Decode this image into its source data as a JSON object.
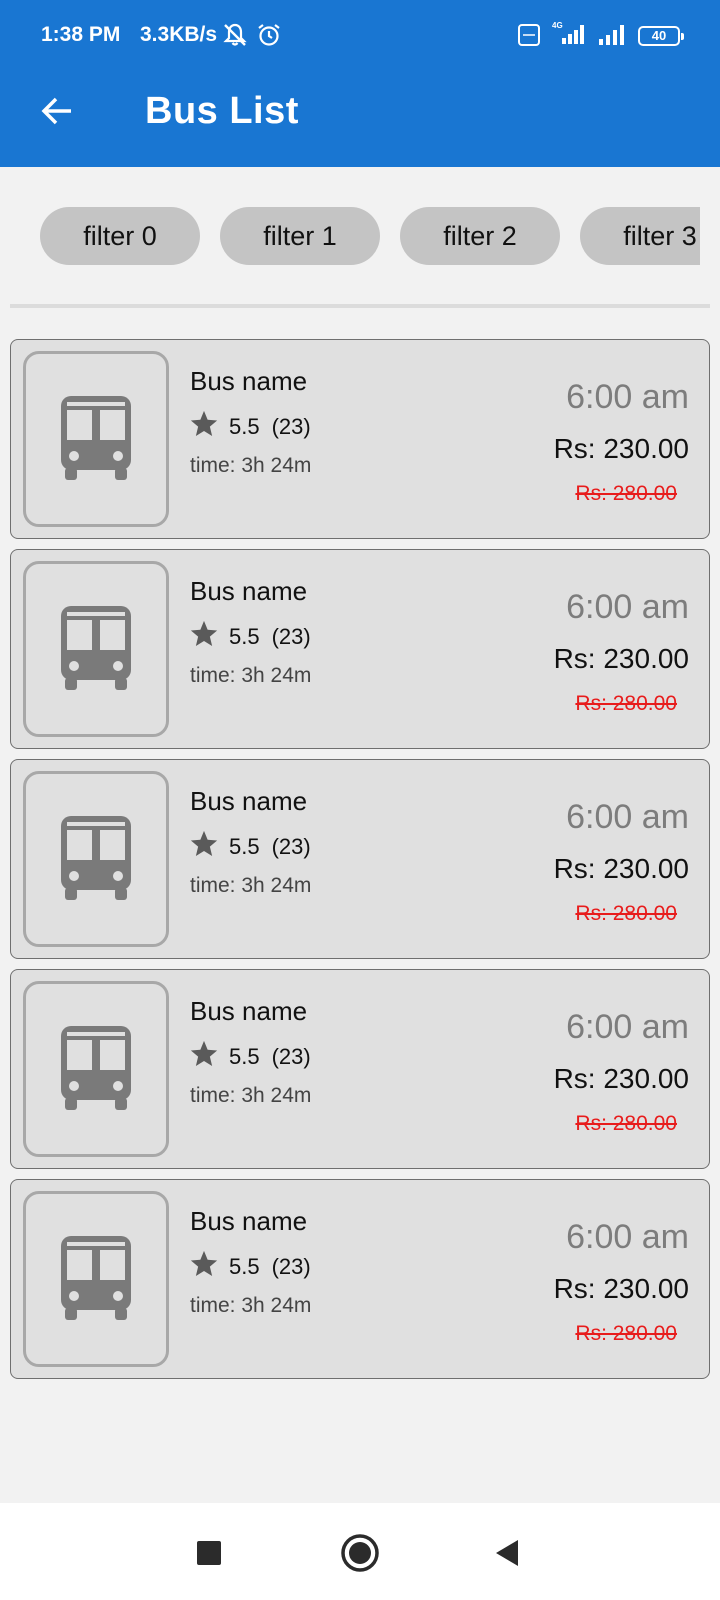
{
  "status_bar": {
    "time": "1:38 PM",
    "network_speed": "3.3KB/s",
    "battery": "40",
    "icons": [
      "bell-off-icon",
      "alarm-icon",
      "volte-icon",
      "signal-4g-icon",
      "signal-icon",
      "battery-icon"
    ]
  },
  "app_bar": {
    "title": "Bus List",
    "back_icon": "arrow-left-icon",
    "color": "#1976d2"
  },
  "filters": [
    "filter 0",
    "filter 1",
    "filter 2",
    "filter 3"
  ],
  "buses": [
    {
      "name": "Bus name",
      "rating": "5.5",
      "reviews": "(23)",
      "duration": "time: 3h 24m",
      "departure": "6:00 am",
      "price": "Rs: 230.00",
      "old_price": "Rs: 280.00"
    },
    {
      "name": "Bus name",
      "rating": "5.5",
      "reviews": "(23)",
      "duration": "time: 3h 24m",
      "departure": "6:00 am",
      "price": "Rs: 230.00",
      "old_price": "Rs: 280.00"
    },
    {
      "name": "Bus name",
      "rating": "5.5",
      "reviews": "(23)",
      "duration": "time: 3h 24m",
      "departure": "6:00 am",
      "price": "Rs: 230.00",
      "old_price": "Rs: 280.00"
    },
    {
      "name": "Bus name",
      "rating": "5.5",
      "reviews": "(23)",
      "duration": "time: 3h 24m",
      "departure": "6:00 am",
      "price": "Rs: 230.00",
      "old_price": "Rs: 280.00"
    },
    {
      "name": "Bus name",
      "rating": "5.5",
      "reviews": "(23)",
      "duration": "time: 3h 24m",
      "departure": "6:00 am",
      "price": "Rs: 230.00",
      "old_price": "Rs: 280.00"
    }
  ],
  "colors": {
    "old_price": "#e81c1c",
    "departure": "#7d7d7d",
    "card_bg": "#e0e0e0"
  },
  "nav_bar": {
    "buttons": [
      "recents-square-icon",
      "home-circle-icon",
      "back-triangle-icon"
    ]
  }
}
